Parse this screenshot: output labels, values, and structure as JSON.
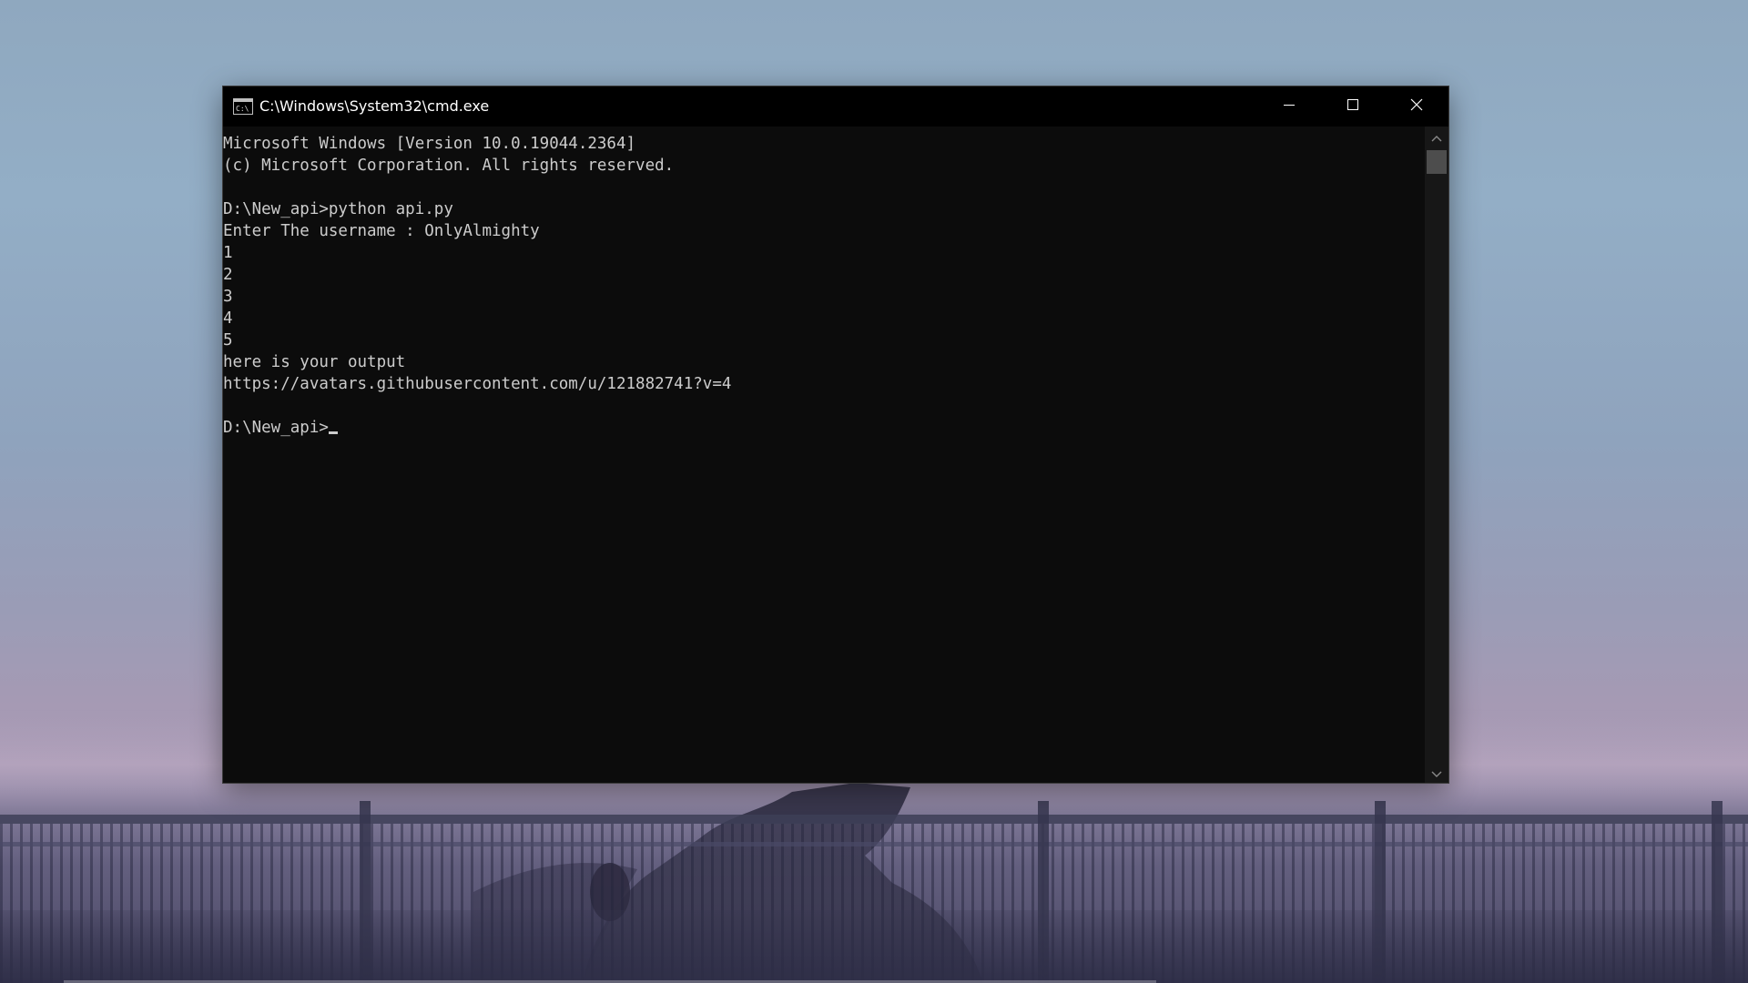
{
  "window": {
    "title": "C:\\Windows\\System32\\cmd.exe",
    "icon": "cmd-icon",
    "controls": {
      "minimize_icon": "minimize-icon",
      "maximize_icon": "maximize-icon",
      "close_icon": "close-icon"
    }
  },
  "console": {
    "lines": [
      "Microsoft Windows [Version 10.0.19044.2364]",
      "(c) Microsoft Corporation. All rights reserved.",
      "",
      "D:\\New_api>python api.py",
      "Enter The username : OnlyAlmighty",
      "1",
      "2",
      "3",
      "4",
      "5",
      "here is your output",
      "https://avatars.githubusercontent.com/u/121882741?v=4",
      ""
    ],
    "prompt": "D:\\New_api>"
  },
  "colors": {
    "console_bg": "#0c0c0c",
    "console_text": "#cccccc",
    "titlebar_bg": "#000000",
    "titlebar_text": "#ffffff"
  }
}
